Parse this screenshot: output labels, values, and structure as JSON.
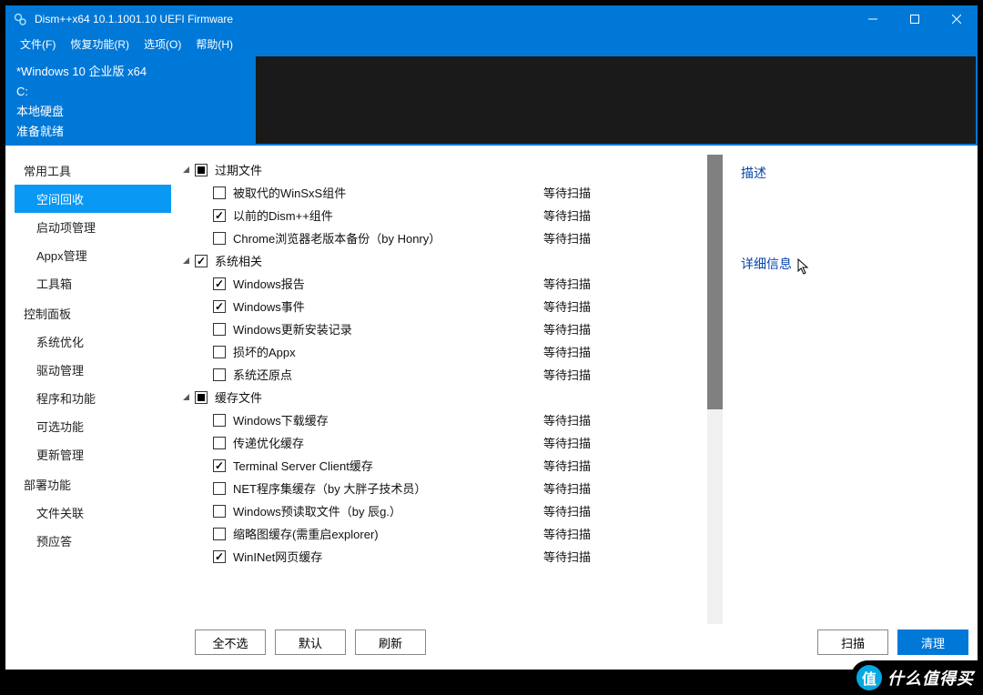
{
  "window": {
    "title": "Dism++x64 10.1.1001.10 UEFI Firmware"
  },
  "menu": {
    "file": "文件(F)",
    "recovery": "恢复功能(R)",
    "options": "选项(O)",
    "help": "帮助(H)"
  },
  "info": {
    "os": "*Windows 10 企业版 x64",
    "drive": "C:",
    "disk": "本地硬盘",
    "status": "准备就绪"
  },
  "sidebar": {
    "groups": [
      {
        "label": "常用工具",
        "items": [
          {
            "label": "空间回收",
            "selected": true
          },
          {
            "label": "启动项管理"
          },
          {
            "label": "Appx管理"
          },
          {
            "label": "工具箱"
          }
        ]
      },
      {
        "label": "控制面板",
        "items": [
          {
            "label": "系统优化"
          },
          {
            "label": "驱动管理"
          },
          {
            "label": "程序和功能"
          },
          {
            "label": "可选功能"
          },
          {
            "label": "更新管理"
          }
        ]
      },
      {
        "label": "部署功能",
        "items": [
          {
            "label": "文件关联"
          },
          {
            "label": "预应答"
          }
        ]
      }
    ]
  },
  "tree": {
    "status_pending": "等待扫描",
    "groups": [
      {
        "label": "过期文件",
        "check": "indet",
        "items": [
          {
            "label": "被取代的WinSxS组件",
            "checked": false
          },
          {
            "label": "以前的Dism++组件",
            "checked": true
          },
          {
            "label": "Chrome浏览器老版本备份（by Honry）",
            "checked": false
          }
        ]
      },
      {
        "label": "系统相关",
        "check": "checked",
        "items": [
          {
            "label": "Windows报告",
            "checked": true
          },
          {
            "label": "Windows事件",
            "checked": true
          },
          {
            "label": "Windows更新安装记录",
            "checked": false
          },
          {
            "label": "损坏的Appx",
            "checked": false
          },
          {
            "label": "系统还原点",
            "checked": false
          }
        ]
      },
      {
        "label": "缓存文件",
        "check": "indet",
        "items": [
          {
            "label": "Windows下载缓存",
            "checked": false
          },
          {
            "label": "传递优化缓存",
            "checked": false
          },
          {
            "label": "Terminal Server Client缓存",
            "checked": true
          },
          {
            "label": "NET程序集缓存（by 大胖子技术员）",
            "checked": false
          },
          {
            "label": "Windows预读取文件（by 辰g.）",
            "checked": false
          },
          {
            "label": "缩略图缓存(需重启explorer)",
            "checked": false
          },
          {
            "label": "WinINet网页缓存",
            "checked": true
          }
        ]
      }
    ]
  },
  "detail": {
    "description": "描述",
    "details": "详细信息"
  },
  "buttons": {
    "select_none": "全不选",
    "default": "默认",
    "refresh": "刷新",
    "scan": "扫描",
    "clean": "清理"
  },
  "watermark": {
    "icon": "值",
    "text": "什么值得买"
  }
}
